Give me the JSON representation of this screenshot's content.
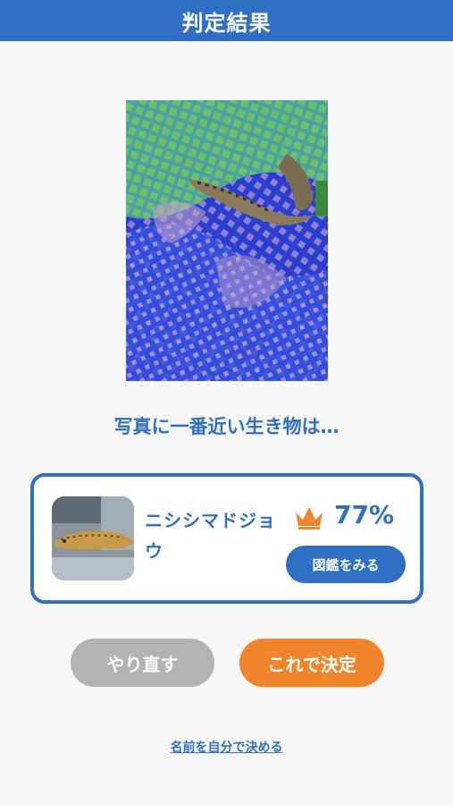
{
  "header": {
    "title": "判定結果"
  },
  "question": "写真に一番近い生き物は…",
  "result": {
    "name": "ニシシマドジョウ",
    "percent": "77%",
    "crown_icon": "crown-icon",
    "zukan_button": "図鑑をみる"
  },
  "actions": {
    "redo_label": "やり直す",
    "decide_label": "これで決定"
  },
  "self_name_link": "名前を自分で決める",
  "colors": {
    "primary": "#2f6fc4",
    "accent": "#f0852d",
    "neutral_button": "#b3b3b3",
    "background": "#f7f7f7"
  }
}
